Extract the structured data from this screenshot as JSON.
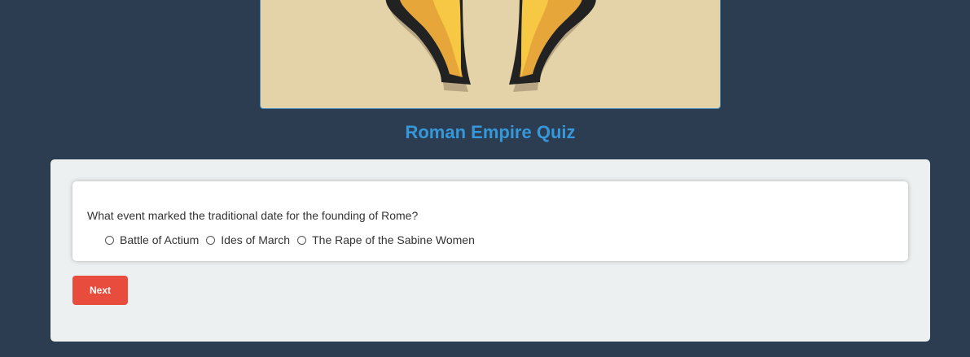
{
  "page": {
    "title": "Roman Empire Quiz"
  },
  "hero": {
    "icon": "spartan-helmet-icon"
  },
  "quiz": {
    "question": "What event marked the traditional date for the founding of Rome?",
    "options": [
      "Battle of Actium",
      "Ides of March",
      "The Rape of the Sabine Women"
    ],
    "selected_option": null
  },
  "actions": {
    "next_label": "Next"
  },
  "colors": {
    "background": "#2d3d51",
    "title": "#3498db",
    "panel": "#ecf0f1",
    "button": "#e74c3c",
    "hero": "#e4d3a8"
  }
}
